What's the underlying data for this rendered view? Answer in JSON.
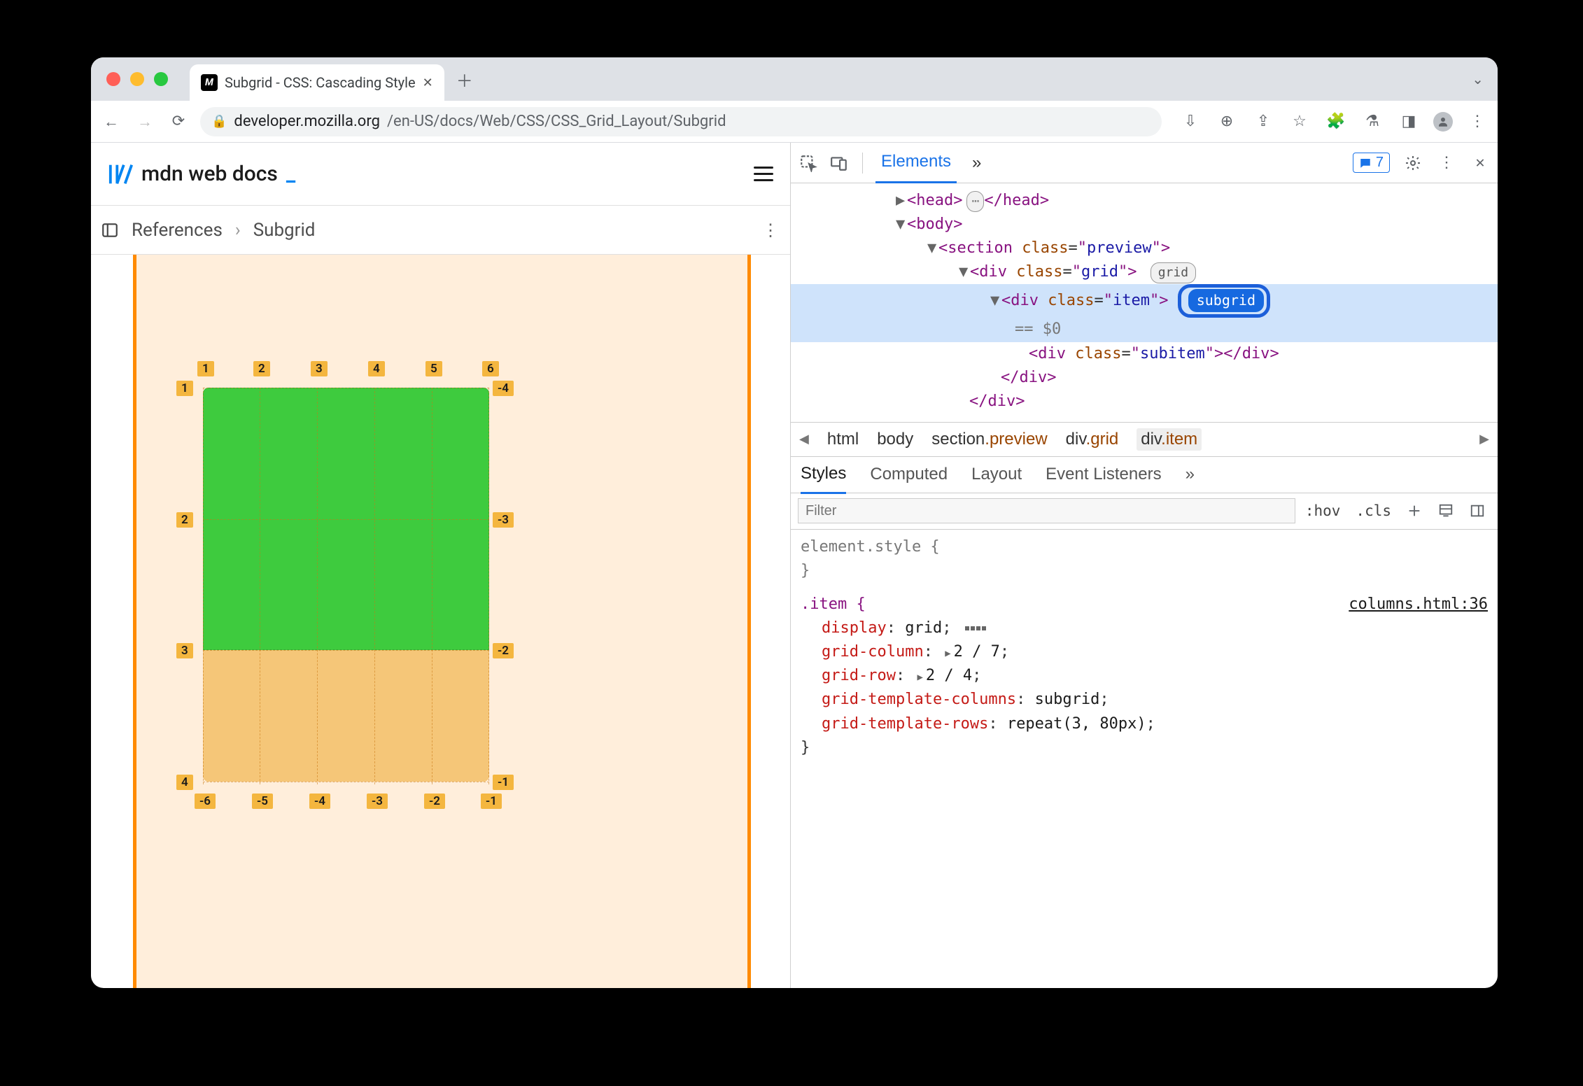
{
  "browser": {
    "tab_title": "Subgrid - CSS: Cascading Style",
    "url_host": "developer.mozilla.org",
    "url_path": "/en-US/docs/Web/CSS/CSS_Grid_Layout/Subgrid",
    "issues_count": "7"
  },
  "mdn": {
    "logo_text": "mdn web docs",
    "crumb1": "References",
    "crumb2": "Subgrid",
    "grid_labels_top": [
      "1",
      "2",
      "3",
      "4",
      "5",
      "6"
    ],
    "grid_labels_left": [
      "1",
      "2",
      "3",
      "4"
    ],
    "grid_labels_right": [
      "-4",
      "-3",
      "-2",
      "-1"
    ],
    "grid_labels_bottom": [
      "-6",
      "-5",
      "-4",
      "-3",
      "-2",
      "-1"
    ]
  },
  "devtools": {
    "panel": "Elements",
    "more": "»",
    "dom": {
      "l0": "<head>…</head>",
      "l1": "<body>",
      "l2a": "<section class=\"preview\">",
      "l3a": "<div class=\"grid\">",
      "badge_grid": "grid",
      "l4a": "<div class=\"item\">",
      "badge_sub": "subgrid",
      "l4eq": "== $0",
      "l5": "<div class=\"subitem\"></div>",
      "l4c": "</div>",
      "l3c": "</div>"
    },
    "crumbs": [
      "html",
      "body",
      "section.preview",
      "div.grid",
      "div.item"
    ],
    "subtabs": [
      "Styles",
      "Computed",
      "Layout",
      "Event Listeners"
    ],
    "filter_placeholder": "Filter",
    "hov": ":hov",
    "cls": ".cls",
    "styles": {
      "element_style": "element.style {",
      "element_style_close": "}",
      "rule_selector": ".item {",
      "rule_source": "columns.html:36",
      "decl1_p": "display",
      "decl1_v": "grid",
      "decl2_p": "grid-column",
      "decl2_v": "2 / 7",
      "decl3_p": "grid-row",
      "decl3_v": "2 / 4",
      "decl4_p": "grid-template-columns",
      "decl4_v": "subgrid",
      "decl5_p": "grid-template-rows",
      "decl5_v": "repeat(3, 80px)",
      "rule_close": "}"
    }
  }
}
